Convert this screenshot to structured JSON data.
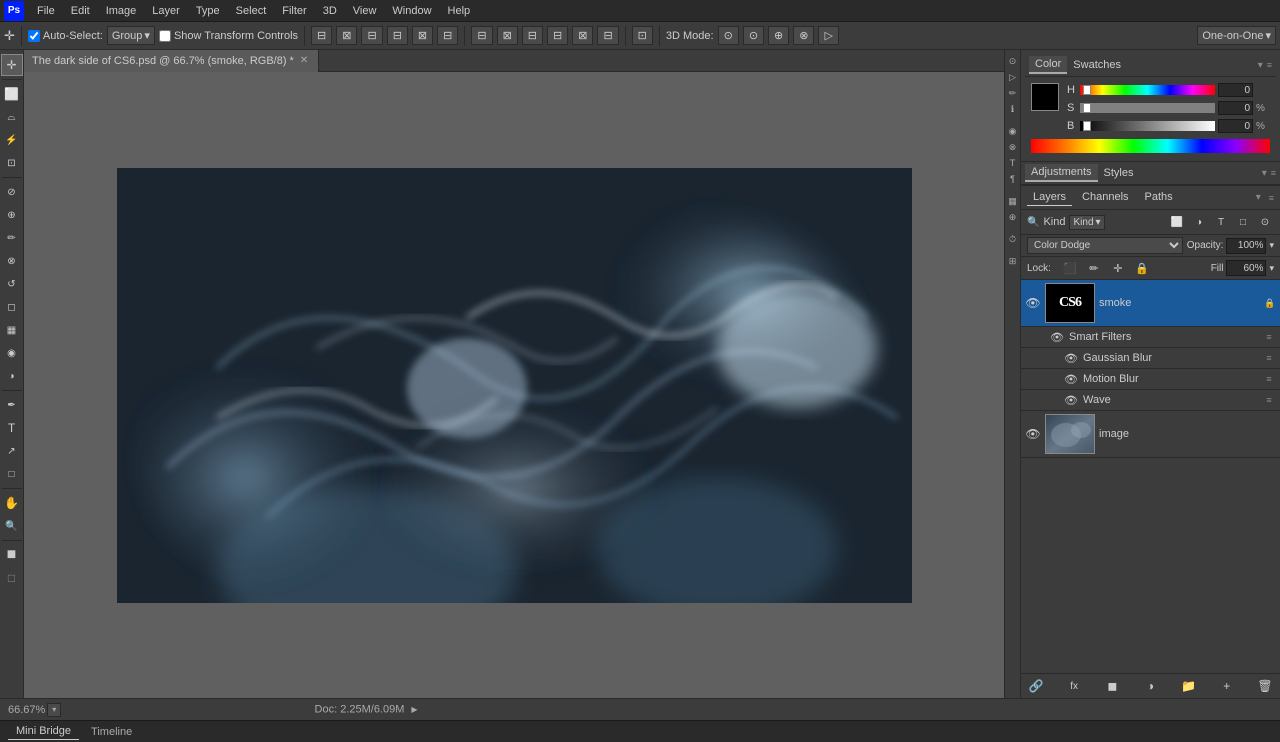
{
  "app": {
    "logo": "PS",
    "menu": [
      "File",
      "Edit",
      "Image",
      "Layer",
      "Type",
      "Select",
      "Filter",
      "3D",
      "View",
      "Window",
      "Help"
    ]
  },
  "toolbar": {
    "auto_select_label": "Auto-Select:",
    "auto_select_value": "Group",
    "show_transform": "Show Transform Controls",
    "3d_mode_label": "3D Mode:",
    "view_mode": "One-on-One"
  },
  "tab": {
    "title": "The dark side of CS6.psd @ 66.7% (smoke, RGB/8) *"
  },
  "statusbar": {
    "zoom": "66.67%",
    "doc_info": "Doc: 2.25M/6.09M"
  },
  "bottom_tabs": {
    "items": [
      "Mini Bridge",
      "Timeline"
    ]
  },
  "bottom_left_text": "Bridge",
  "color_panel": {
    "tabs": [
      "Color",
      "Swatches"
    ],
    "active_tab": "Color",
    "h_label": "H",
    "s_label": "S",
    "b_label": "B",
    "h_value": "0",
    "h_unit": "",
    "s_value": "0",
    "s_unit": "%",
    "b_value": "0",
    "b_unit": "%"
  },
  "adj_panel": {
    "tabs": [
      "Adjustments",
      "Styles"
    ],
    "active_tab": "Adjustments"
  },
  "layers_panel": {
    "title": "Layers",
    "tabs": [
      "Layers",
      "Channels",
      "Paths"
    ],
    "active_tab": "Layers",
    "kind_label": "Kind",
    "blend_mode": "Color Dodge",
    "opacity_label": "Opacity:",
    "opacity_value": "100%",
    "lock_label": "Lock:",
    "fill_label": "Fill",
    "fill_value": "60%",
    "layers": [
      {
        "name": "smoke",
        "type": "cs6",
        "visible": true,
        "active": true,
        "has_sublayers": true,
        "sublayers": [
          {
            "name": "Smart Filters",
            "visible": true,
            "type": "group"
          },
          {
            "name": "Gaussian Blur",
            "visible": true,
            "type": "filter"
          },
          {
            "name": "Motion Blur",
            "visible": true,
            "type": "filter"
          },
          {
            "name": "Wave",
            "visible": true,
            "type": "filter"
          }
        ]
      },
      {
        "name": "image",
        "type": "image",
        "visible": true,
        "active": false,
        "has_sublayers": false
      }
    ]
  },
  "icons": {
    "eye": "👁",
    "lock": "🔒",
    "chain": "🔗",
    "search": "🔍",
    "move": "✛",
    "arrow": "↖",
    "marquee": "⬜",
    "lasso": "∞",
    "wand": "⚡",
    "crop": "⊡",
    "eyedropper": "⊘",
    "heal": "⊕",
    "brush": "✏",
    "clone": "⊗",
    "eraser": "◻",
    "gradient": "▦",
    "blur": "◉",
    "dodge": "◑",
    "pen": "✒",
    "text": "T",
    "shape": "□",
    "hand": "✋",
    "zoom": "⊕",
    "fg_bg": "■",
    "new_layer": "+",
    "delete_layer": "🗑",
    "fx": "fx",
    "mask": "◼",
    "adj": "◑",
    "folder": "📁",
    "link": "🔗"
  }
}
